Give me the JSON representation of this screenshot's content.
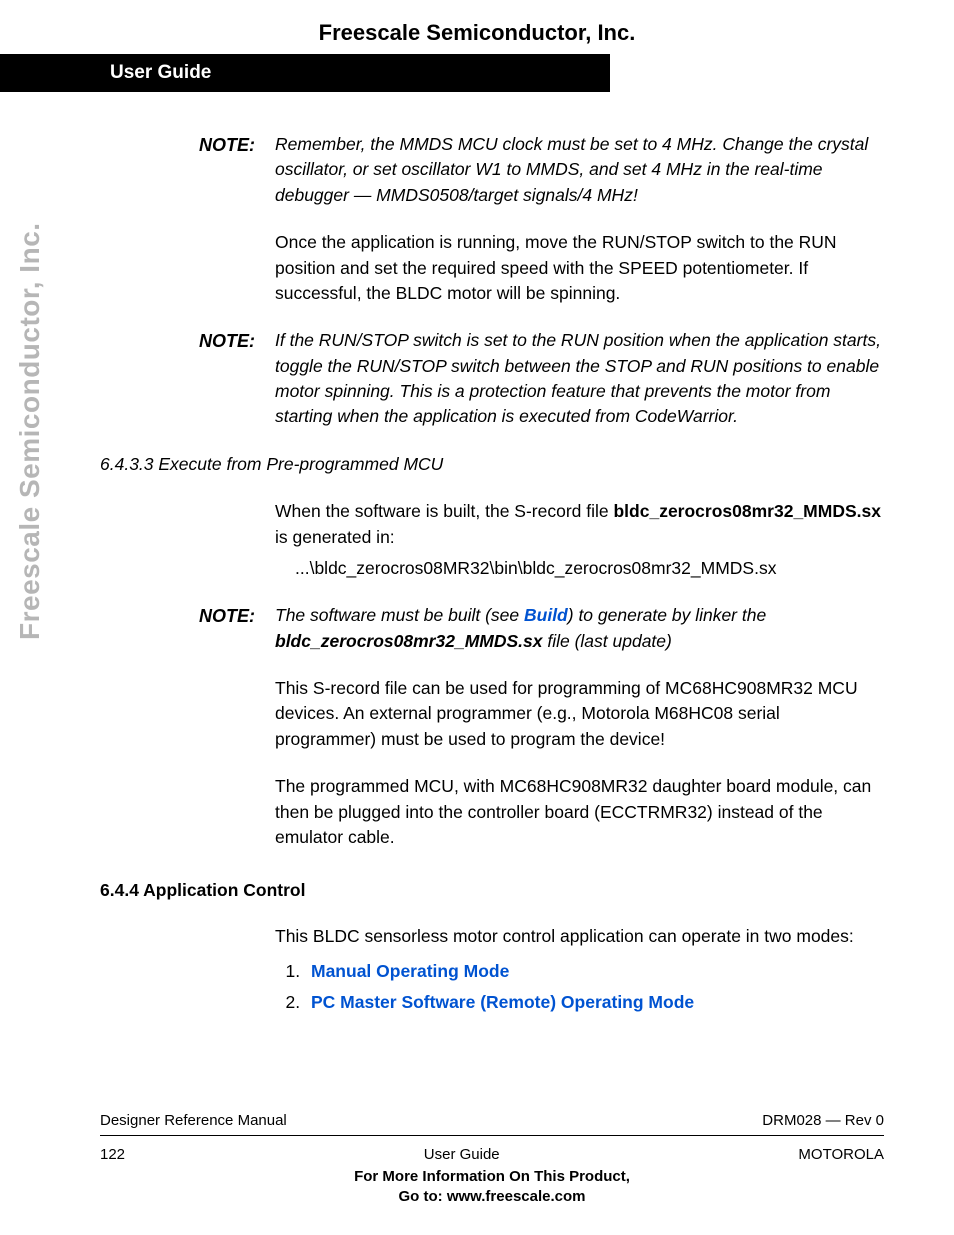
{
  "header": {
    "company": "Freescale Semiconductor, Inc.",
    "bar_title": "User Guide"
  },
  "vertical_label": "Freescale Semiconductor, Inc.",
  "notes": {
    "label": "NOTE:",
    "n1": "Remember, the MMDS MCU clock must be set to 4 MHz. Change the crystal oscillator, or set oscillator W1 to MMDS, and set 4 MHz in the real-time debugger — MMDS0508/target signals/4 MHz!",
    "n2": "If the RUN/STOP switch is set to the RUN position when the application starts, toggle the RUN/STOP switch between the STOP and RUN positions to enable motor spinning. This is a protection feature that prevents the motor from starting when the application is executed from CodeWarrior.",
    "n3_pre": "The software must be built (see ",
    "n3_link": "Build",
    "n3_mid": ") to generate by linker the ",
    "n3_file": "bldc_zerocros08mr32_MMDS.sx",
    "n3_post": " file (last update)"
  },
  "paras": {
    "p1": "Once the application is running, move the RUN/STOP switch to the RUN position and set the required speed with the SPEED potentiometer. If successful, the BLDC motor will be spinning.",
    "p2_pre": "When the software is built, the S-record file ",
    "p2_file": "bldc_zerocros08mr32_MMDS.sx",
    "p2_post": " is generated in:",
    "p2_path": "...\\bldc_zerocros08MR32\\bin\\bldc_zerocros08mr32_MMDS.sx",
    "p3": "This S-record file can be used for programming of MC68HC908MR32 MCU devices. An external programmer (e.g., Motorola M68HC08 serial programmer) must be used to program the device!",
    "p4": "The programmed MCU, with MC68HC908MR32 daughter board module, can then be plugged into the controller board (ECCTRMR32) instead of the emulator cable.",
    "p5": "This BLDC sensorless motor control application can operate in two modes:"
  },
  "headings": {
    "h6433": "6.4.3.3  Execute from Pre-programmed MCU",
    "h644": "6.4.4  Application Control"
  },
  "list": {
    "item1": "Manual Operating Mode",
    "item2": "PC Master Software (Remote) Operating Mode"
  },
  "footer": {
    "left1": "Designer Reference Manual",
    "right1": "DRM028 — Rev 0",
    "left2": "122",
    "mid2": "User Guide",
    "right2": "MOTOROLA",
    "bold1": "For More Information On This Product,",
    "bold2": "Go to: www.freescale.com"
  }
}
